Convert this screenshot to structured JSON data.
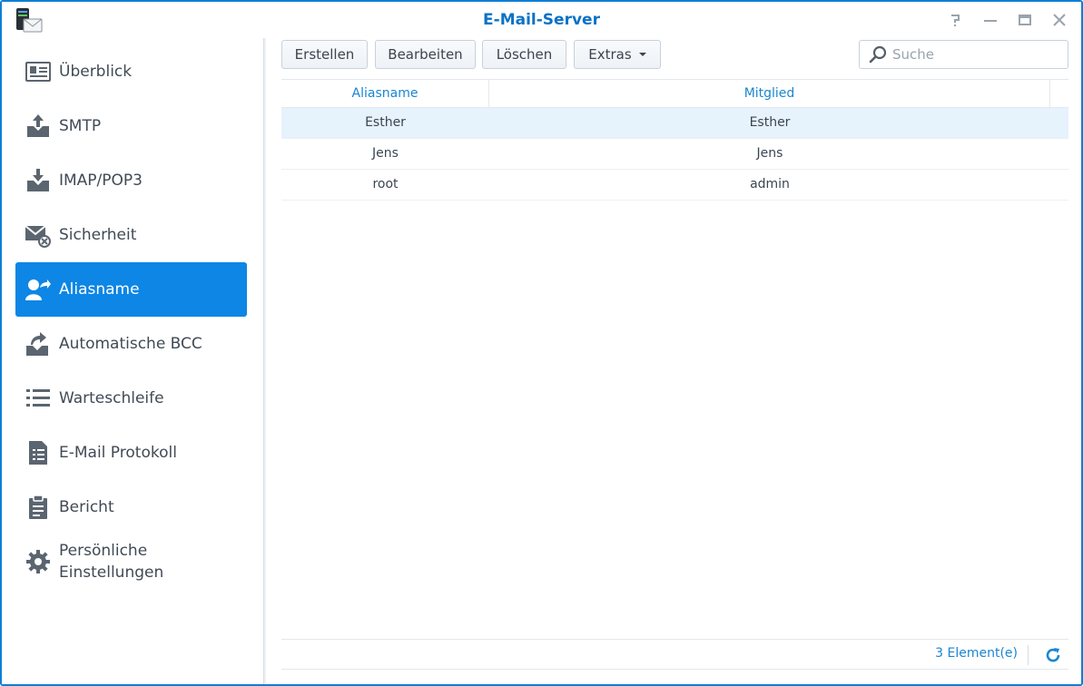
{
  "window": {
    "title": "E-Mail-Server",
    "controls": [
      "help-icon",
      "minimize-icon",
      "maximize-icon",
      "close-icon"
    ]
  },
  "sidebar": {
    "items": [
      {
        "label": "Überblick",
        "icon": "overview-icon"
      },
      {
        "label": "SMTP",
        "icon": "smtp-upload-icon"
      },
      {
        "label": "IMAP/POP3",
        "icon": "imap-download-icon"
      },
      {
        "label": "Sicherheit",
        "icon": "mail-security-icon"
      },
      {
        "label": "Aliasname",
        "icon": "alias-user-icon",
        "active": true
      },
      {
        "label": "Automatische BCC",
        "icon": "auto-bcc-icon"
      },
      {
        "label": "Warteschleife",
        "icon": "queue-list-icon"
      },
      {
        "label": "E-Mail Protokoll",
        "icon": "mail-log-icon"
      },
      {
        "label": "Bericht",
        "icon": "report-clipboard-icon"
      },
      {
        "label_line1": "Persönliche",
        "label_line2": "Einstellungen",
        "icon": "gear-icon"
      }
    ]
  },
  "toolbar": {
    "create_label": "Erstellen",
    "edit_label": "Bearbeiten",
    "delete_label": "Löschen",
    "extras_label": "Extras"
  },
  "search": {
    "placeholder": "Suche"
  },
  "grid": {
    "columns": [
      "Aliasname",
      "Mitglied"
    ],
    "rows": [
      {
        "alias": "Esther",
        "member": "Esther",
        "selected": true
      },
      {
        "alias": "Jens",
        "member": "Jens"
      },
      {
        "alias": "root",
        "member": "admin"
      }
    ]
  },
  "footer": {
    "count": "3 Element(e)"
  },
  "colors": {
    "accent": "#0d86e6",
    "title": "#0b72c6",
    "link": "#1a86d0"
  }
}
